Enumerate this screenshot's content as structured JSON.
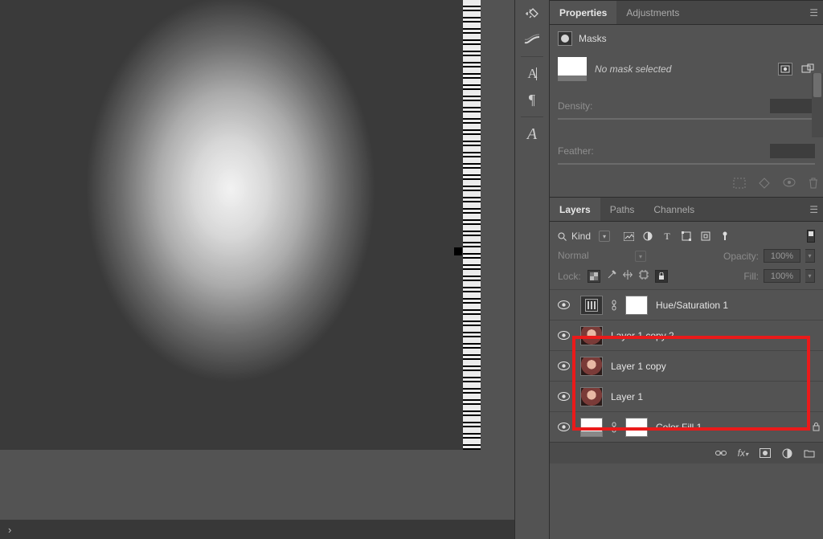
{
  "panels": {
    "properties": {
      "tab_properties": "Properties",
      "tab_adjustments": "Adjustments"
    },
    "layers": {
      "tab_layers": "Layers",
      "tab_paths": "Paths",
      "tab_channels": "Channels"
    }
  },
  "properties": {
    "section_title": "Masks",
    "no_mask_text": "No mask selected",
    "density_label": "Density:",
    "feather_label": "Feather:"
  },
  "layers_panel": {
    "kind_label": "Kind",
    "blend_mode": "Normal",
    "opacity_label": "Opacity:",
    "opacity_value": "100%",
    "lock_label": "Lock:",
    "fill_label": "Fill:",
    "fill_value": "100%",
    "layers": [
      {
        "name": "Hue/Saturation 1",
        "type": "adjustment",
        "linked_mask": true
      },
      {
        "name": "Layer 1 copy 2",
        "type": "pixel"
      },
      {
        "name": "Layer 1 copy",
        "type": "pixel"
      },
      {
        "name": "Layer 1",
        "type": "pixel"
      },
      {
        "name": "Color Fill 1",
        "type": "fill",
        "linked_mask": true
      }
    ]
  },
  "highlight": {
    "covers_layers": [
      "Layer 1 copy 2",
      "Layer 1 copy",
      "Layer 1"
    ]
  }
}
